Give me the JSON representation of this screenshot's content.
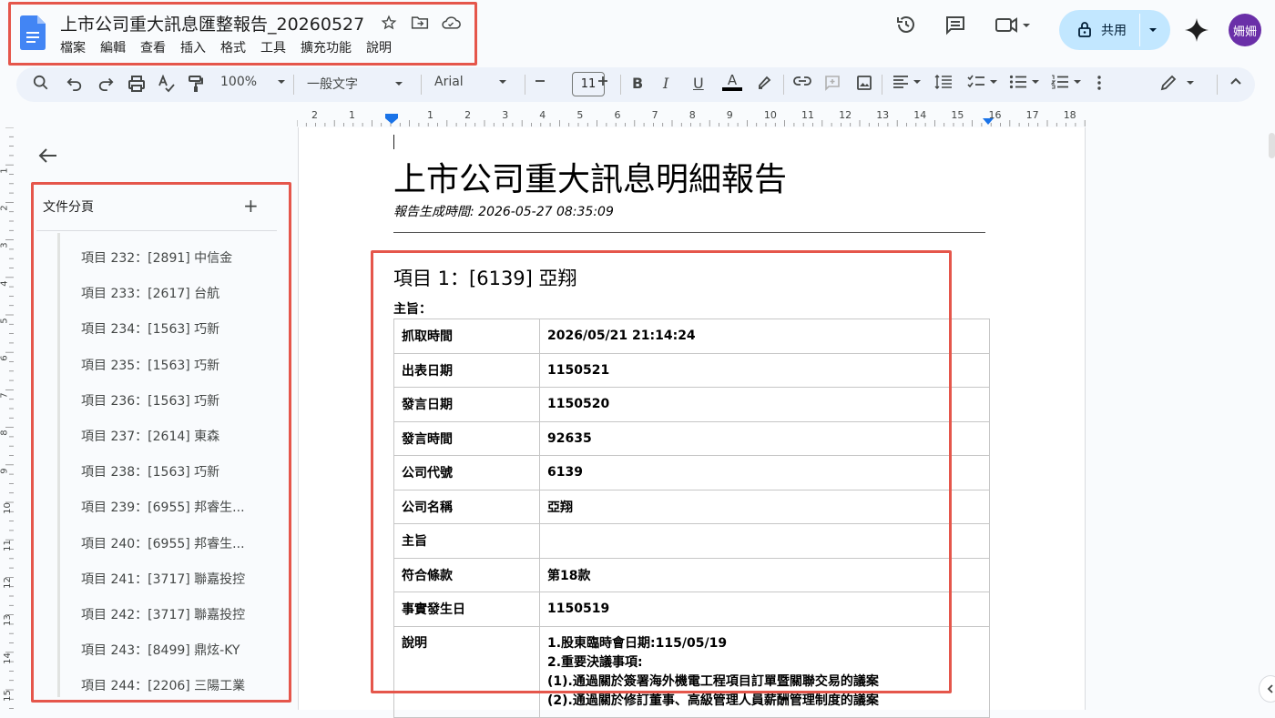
{
  "document": {
    "title": "上市公司重大訊息匯整報告_20260527"
  },
  "menu": [
    "檔案",
    "編輯",
    "查看",
    "插入",
    "格式",
    "工具",
    "擴充功能",
    "說明"
  ],
  "share": {
    "label": "共用"
  },
  "avatar": {
    "text": "姍姍",
    "color": "#6a2fa8"
  },
  "toolbar": {
    "zoom": "100%",
    "style": "一般文字",
    "font": "Arial",
    "font_size": "11"
  },
  "ruler": {
    "h_numbers": [
      "2",
      "1",
      "1",
      "2",
      "3",
      "4",
      "5",
      "6",
      "7",
      "8",
      "9",
      "10",
      "11",
      "12",
      "13",
      "14",
      "15",
      "16",
      "17",
      "18"
    ],
    "v_numbers": [
      "1",
      "2",
      "3",
      "4",
      "5",
      "6",
      "7",
      "8",
      "9",
      "10",
      "11",
      "12",
      "13",
      "14",
      "15"
    ]
  },
  "sidebar": {
    "heading": "文件分頁",
    "items": [
      "項目 232：[2891] 中信金",
      "項目 233：[2617] 台航",
      "項目 234：[1563] 巧新",
      "項目 235：[1563] 巧新",
      "項目 236：[1563] 巧新",
      "項目 237：[2614] 東森",
      "項目 238：[1563] 巧新",
      "項目 239：[6955] 邦睿生...",
      "項目 240：[6955] 邦睿生...",
      "項目 241：[3717] 聯嘉投控",
      "項目 242：[3717] 聯嘉投控",
      "項目 243：[8499] 鼎炫-KY",
      "項目 244：[2206] 三陽工業"
    ]
  },
  "page": {
    "heading": "上市公司重大訊息明細報告",
    "generated": "報告生成時間: 2026-05-27 08:35:09",
    "item_title": "項目 1：[6139] 亞翔",
    "subject_label": "主旨：",
    "rows": [
      {
        "k": "抓取時間",
        "v": "2026/05/21 21:14:24"
      },
      {
        "k": "出表日期",
        "v": "1150521"
      },
      {
        "k": "發言日期",
        "v": "1150520"
      },
      {
        "k": "發言時間",
        "v": "92635"
      },
      {
        "k": "公司代號",
        "v": "6139"
      },
      {
        "k": "公司名稱",
        "v": "亞翔"
      },
      {
        "k": "主旨",
        "v": ""
      },
      {
        "k": "符合條款",
        "v": "第18款"
      },
      {
        "k": "事實發生日",
        "v": "1150519"
      }
    ],
    "desc_key": "說明",
    "desc_lines": [
      "1.股東臨時會日期:115/05/19",
      "2.重要決議事項:",
      "(1).通過關於簽署海外機電工程項目訂單暨關聯交易的議案",
      "(2).通過關於修訂董事、高級管理人員薪酬管理制度的議案"
    ]
  },
  "colors": {
    "annotation_red": "#e5564b",
    "share_bg": "#c2e7ff",
    "docs_blue": "#4285f4"
  }
}
